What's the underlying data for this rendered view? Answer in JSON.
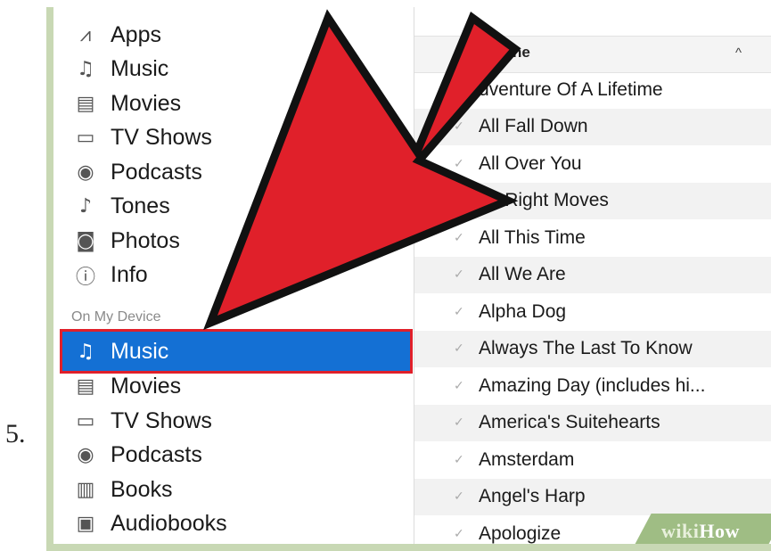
{
  "step_number": "5.",
  "sidebar": {
    "library_items": [
      {
        "icon": "apps-icon",
        "glyph": "⩘",
        "label": "Apps"
      },
      {
        "icon": "music-note-icon",
        "glyph": "♫",
        "label": "Music"
      },
      {
        "icon": "film-icon",
        "glyph": "▤",
        "label": "Movies"
      },
      {
        "icon": "tv-icon",
        "glyph": "▭",
        "label": "TV Shows"
      },
      {
        "icon": "podcast-icon",
        "glyph": "◉",
        "label": "Podcasts"
      },
      {
        "icon": "bell-icon",
        "glyph": "♪",
        "label": "Tones"
      },
      {
        "icon": "camera-icon",
        "glyph": "◙",
        "label": "Photos"
      },
      {
        "icon": "info-icon",
        "glyph": "ⓘ",
        "label": "Info"
      }
    ],
    "section_title": "On My Device",
    "device_items": [
      {
        "icon": "music-note-icon",
        "glyph": "♫",
        "label": "Music",
        "selected": true
      },
      {
        "icon": "film-icon",
        "glyph": "▤",
        "label": "Movies",
        "selected": false
      },
      {
        "icon": "tv-icon",
        "glyph": "▭",
        "label": "TV Shows",
        "selected": false
      },
      {
        "icon": "podcast-icon",
        "glyph": "◉",
        "label": "Podcasts",
        "selected": false
      },
      {
        "icon": "books-icon",
        "glyph": "▥",
        "label": "Books",
        "selected": false
      },
      {
        "icon": "audiobook-icon",
        "glyph": "▣",
        "label": "Audiobooks",
        "selected": false
      }
    ]
  },
  "song_list": {
    "column_title": "ne",
    "sort_indicator": "^",
    "check_glyph": "✓",
    "songs": [
      "dventure Of A Lifetime",
      "All Fall Down",
      "All Over You",
      "he Right Moves",
      "All This Time",
      "All We Are",
      "Alpha Dog",
      "Always The Last To Know",
      "Amazing Day (includes hi...",
      "America's Suitehearts",
      "Amsterdam",
      "Angel's Harp",
      "Apologize"
    ]
  },
  "watermark": {
    "part1": "wiki",
    "part2": "How"
  },
  "colors": {
    "selection": "#1470d4",
    "highlight_border": "#e0202a",
    "arrow": "#e0202a",
    "frame": "#c8d8b4"
  }
}
